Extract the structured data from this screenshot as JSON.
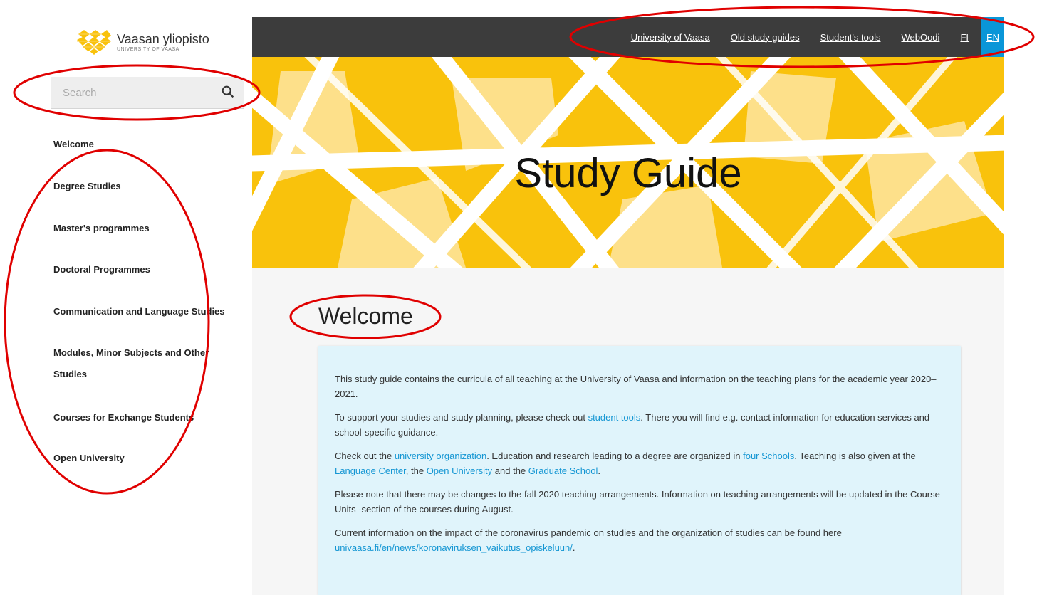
{
  "logo": {
    "name": "Vaasan yliopisto",
    "sub": "UNIVERSITY OF VAASA"
  },
  "search": {
    "placeholder": "Search"
  },
  "sidebar": {
    "items": [
      {
        "label": "Welcome"
      },
      {
        "label": "Degree Studies"
      },
      {
        "label": "Master's programmes"
      },
      {
        "label": "Doctoral Programmes"
      },
      {
        "label": "Communication and Language Studies"
      },
      {
        "label": "Modules, Minor Subjects and Other Studies"
      },
      {
        "label": "Courses for Exchange Students"
      },
      {
        "label": "Open University"
      }
    ]
  },
  "topnav": {
    "links": [
      {
        "label": "University of Vaasa"
      },
      {
        "label": "Old study guides"
      },
      {
        "label": "Student's tools"
      },
      {
        "label": "WebOodi"
      },
      {
        "label": "FI"
      }
    ],
    "active_lang": "EN"
  },
  "hero": {
    "title": "Study Guide"
  },
  "main": {
    "heading": "Welcome",
    "p1": "This study guide contains the curricula of all teaching at the University of Vaasa and information on the teaching plans for the academic year 2020–2021.",
    "p2_a": "To support your studies and study planning, please check out ",
    "p2_link": "student tools",
    "p2_b": ". There you will find e.g. contact information for education services and school-specific guidance.",
    "p3_a": "Check out the ",
    "p3_link1": "university organization",
    "p3_b": ". Education and research leading to a degree are organized in ",
    "p3_link2": "four Schools",
    "p3_c": ". Teaching is also given at the ",
    "p3_link3": "Language Center",
    "p3_d": ", the ",
    "p3_link4": "Open University",
    "p3_e": " and the ",
    "p3_link5": "Graduate School",
    "p3_f": ".",
    "p4": "Please note that there may be changes to the fall 2020 teaching arrangements. Information on teaching arrangements will be updated in the Course Units -section of the courses during August.",
    "p5": "Current information on the impact of the coronavirus pandemic on studies and the organization of studies can be found here",
    "p5_link": "univaasa.fi/en/news/koronaviruksen_vaikutus_opiskeluun/",
    "p5_end": "."
  },
  "colors": {
    "accent_blue": "#0a96d8",
    "hero_yellow": "#f9c20c",
    "topbar": "#3c3c3c",
    "annotation_red": "#e00000"
  }
}
